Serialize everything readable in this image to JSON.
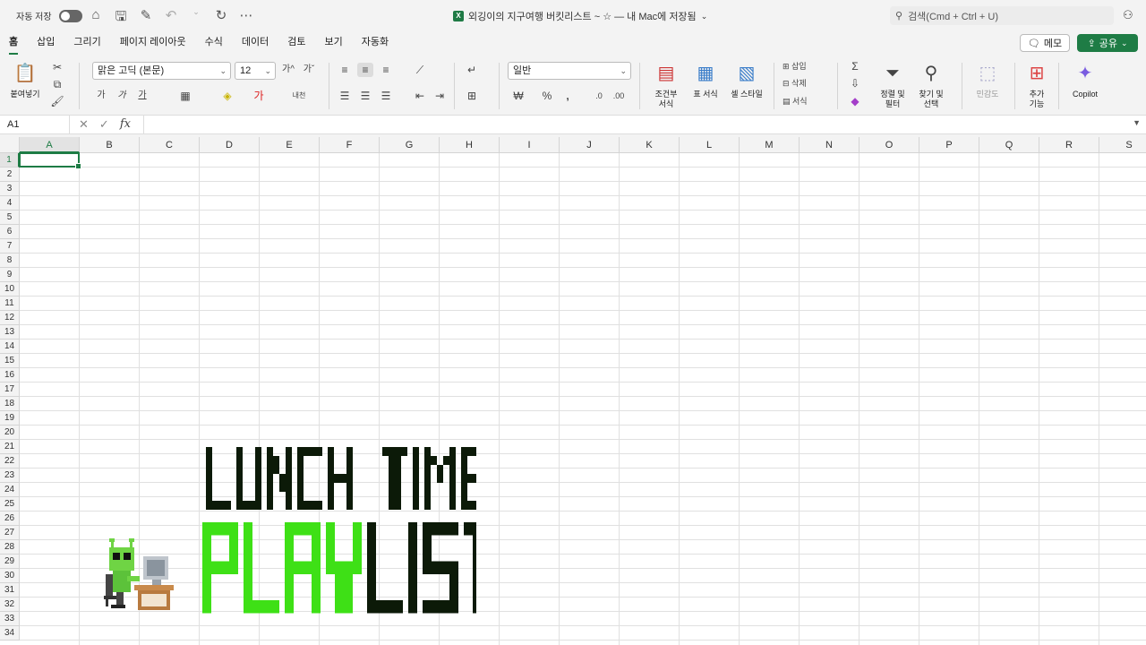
{
  "titlebar": {
    "autosave_label": "자동 저장",
    "doc_title": "외깅이의 지구여행 버킷리스트 ~ ☆ — 내 Mac에 저장됨",
    "search_placeholder": "검색(Cmd + Ctrl + U)"
  },
  "tabs": [
    {
      "label": "홈",
      "active": true
    },
    {
      "label": "삽입"
    },
    {
      "label": "그리기"
    },
    {
      "label": "페이지 레이아웃"
    },
    {
      "label": "수식"
    },
    {
      "label": "데이터"
    },
    {
      "label": "검토"
    },
    {
      "label": "보기"
    },
    {
      "label": "자동화"
    }
  ],
  "buttons": {
    "memo": "메모",
    "share": "공유"
  },
  "ribbon": {
    "paste": "붙여넣기",
    "font_name": "맑은 고딕 (본문)",
    "font_size": "12",
    "number_format": "일반",
    "conditional_format": [
      "조건부",
      "서식"
    ],
    "table_format": "표 서식",
    "cell_style": "셀 스타일",
    "insert": "삽입",
    "delete": "삭제",
    "format": "서식",
    "sort_filter": [
      "정렬 및",
      "필터"
    ],
    "find_select": [
      "찾기 및",
      "선택"
    ],
    "sensitivity": "민감도",
    "addins": [
      "추가",
      "기능"
    ],
    "copilot": "Copilot",
    "bold_glyph": "가",
    "italic_glyph": "가",
    "underline_glyph": "가"
  },
  "formula_bar": {
    "cell_ref": "A1",
    "fx": "fx",
    "value": ""
  },
  "columns": [
    "A",
    "B",
    "C",
    "D",
    "E",
    "F",
    "G",
    "H",
    "I",
    "J",
    "K",
    "L",
    "M",
    "N",
    "O",
    "P",
    "Q",
    "R",
    "S"
  ],
  "rows": [
    "1",
    "2",
    "3",
    "4",
    "5",
    "6",
    "7",
    "8",
    "9",
    "10",
    "11",
    "12",
    "13",
    "14",
    "15",
    "16",
    "17",
    "18",
    "19",
    "20",
    "21",
    "22",
    "23",
    "24",
    "25",
    "26",
    "27",
    "28",
    "29",
    "30",
    "31",
    "32",
    "33",
    "34"
  ],
  "selected_cell": "A1",
  "artwork": {
    "line1": "LUNCH TIME",
    "line2_green": "PLAY",
    "line2_dark": "LIST",
    "green": "#3ee016",
    "dark": "#0c1a08"
  },
  "colors": {
    "accent": "#1e7c45"
  }
}
